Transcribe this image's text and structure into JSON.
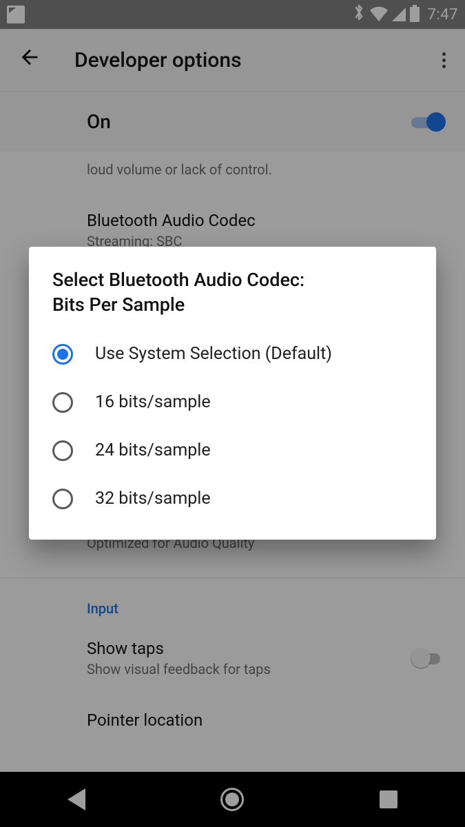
{
  "statusbar": {
    "time": "7:47"
  },
  "appbar": {
    "title": "Developer options"
  },
  "onrow": {
    "label": "On"
  },
  "background": {
    "truncated_text": "loud volume or lack of control.",
    "codec_title": "Bluetooth Audio Codec",
    "codec_summary": "Streaming: SBC",
    "quality_summary": "Optimized for Audio Quality",
    "section_input": "Input",
    "show_taps_title": "Show taps",
    "show_taps_summary": "Show visual feedback for taps",
    "pointer_title": "Pointer location"
  },
  "dialog": {
    "title_line1": "Select Bluetooth Audio Codec:",
    "title_line2": "Bits Per Sample",
    "options": [
      {
        "label": "Use System Selection (Default)",
        "selected": true
      },
      {
        "label": "16 bits/sample",
        "selected": false
      },
      {
        "label": "24 bits/sample",
        "selected": false
      },
      {
        "label": "32 bits/sample",
        "selected": false
      }
    ]
  }
}
